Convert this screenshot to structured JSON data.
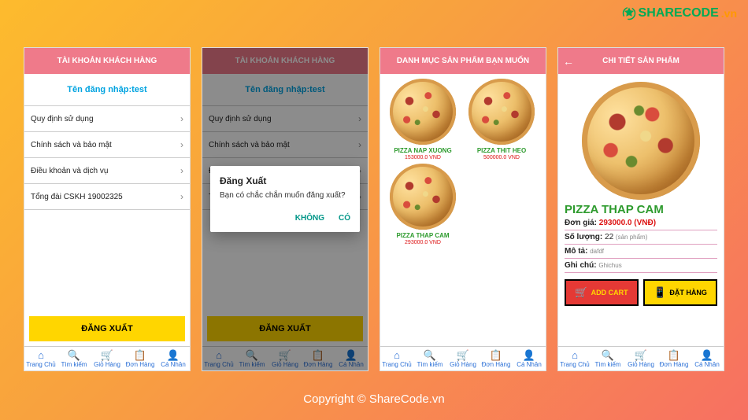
{
  "brand": {
    "name_main": "SHARECODE",
    "name_suffix": ".vn"
  },
  "watermark": "ShareCode.vn",
  "copyright": "Copyright © ShareCode.vn",
  "nav": {
    "items": [
      {
        "icon": "⌂",
        "label": "Trang Chủ"
      },
      {
        "icon": "🔍",
        "label": "Tìm kiếm"
      },
      {
        "icon": "🛒",
        "label": "Giỏ Hàng"
      },
      {
        "icon": "📋",
        "label": "Đơn Hàng"
      },
      {
        "icon": "👤",
        "label": "Cá Nhân"
      }
    ]
  },
  "screen1": {
    "header": "TÀI KHOẢN KHÁCH HÀNG",
    "username_line": "Tên đăng nhập:test",
    "menu": [
      "Quy định sử dụng",
      "Chính sách và bảo mật",
      "Điều khoản và dịch vụ",
      "Tổng đài CSKH 19002325"
    ],
    "logout": "ĐĂNG XUẤT"
  },
  "screen2": {
    "header": "TÀI KHOẢN KHÁCH HÀNG",
    "username_line": "Tên đăng nhập:test",
    "menu": [
      "Quy định sử dụng",
      "Chính sách và bảo mật",
      "Đ",
      "Tổ"
    ],
    "logout": "ĐĂNG XUẤT",
    "dialog": {
      "title": "Đăng Xuất",
      "message": "Bạn có chắc chắn muốn đăng xuất?",
      "no": "KHÔNG",
      "yes": "CÓ"
    }
  },
  "screen3": {
    "header": "DANH MỤC SẢN PHẨM BẠN MUỐN",
    "products": [
      {
        "name": "PIZZA NAP XUONG",
        "price": "153000.0 VND"
      },
      {
        "name": "PIZZA THIT HEO",
        "price": "500000.0 VND"
      },
      {
        "name": "PIZZA THAP CAM",
        "price": "293000.0 VND"
      }
    ]
  },
  "screen4": {
    "header": "CHI TIẾT SẢN PHẨM",
    "name": "PIZZA THAP CAM",
    "price_label": "Đơn giá:",
    "price_value": "293000.0",
    "price_unit": "(VNĐ)",
    "qty_label": "Số lượng:",
    "qty_value": "22",
    "qty_unit": "(sản phẩm)",
    "desc_label": "Mô tả:",
    "desc_value": "dafdf",
    "note_label": "Ghi chú:",
    "note_value": "Ghichus",
    "btn_addcart": "ADD CART",
    "btn_order": "ĐẶT HÀNG"
  }
}
